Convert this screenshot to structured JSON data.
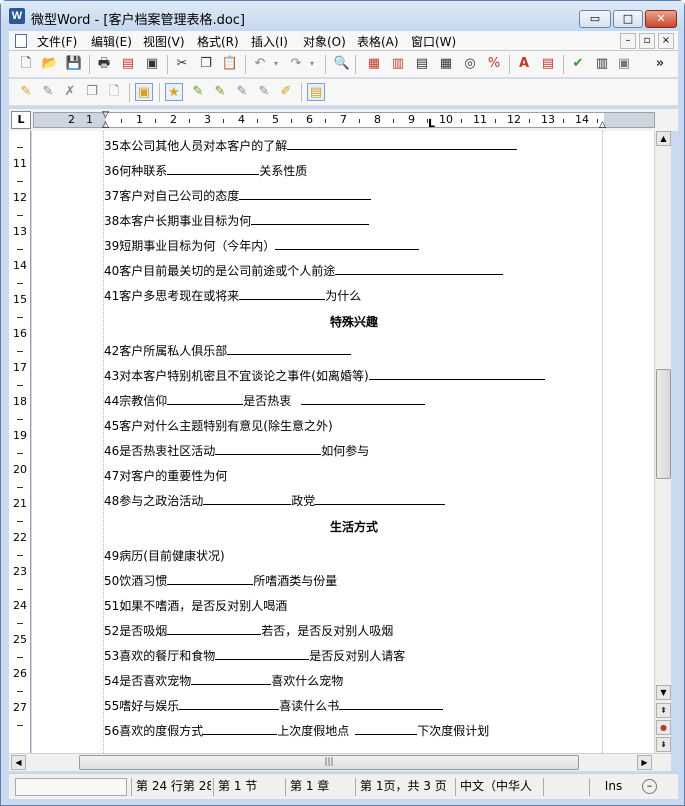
{
  "window": {
    "title": "微型Word - [客户档案管理表格.doc]",
    "app_icon_letter": "W",
    "min_glyph": "▭",
    "max_glyph": "□",
    "close_glyph": "✕"
  },
  "menubar": {
    "items": [
      "文件(F)",
      "编辑(E)",
      "视图(V)",
      "格式(R)",
      "插入(I)",
      "对象(O)",
      "表格(A)",
      "窗口(W)"
    ],
    "doc_controls": [
      "–",
      "▫",
      "×"
    ]
  },
  "toolbar": {
    "more_glyph": "»"
  },
  "ruler": {
    "corner_label": "L",
    "h_numbers": [
      "2",
      "1",
      "",
      "1",
      "2",
      "3",
      "4",
      "5",
      "6",
      "7",
      "8",
      "9",
      "10",
      "11",
      "12",
      "13",
      "14"
    ],
    "v_numbers": [
      "11",
      "12",
      "13",
      "14",
      "15",
      "16",
      "17",
      "18",
      "19",
      "20",
      "21",
      "22",
      "23",
      "24",
      "25",
      "26",
      "27"
    ]
  },
  "document": {
    "lines": [
      {
        "t1": "35本公司其他人员对本客户的了解",
        "t2": "",
        "t3": ""
      },
      {
        "t1": "36何种联系",
        "t2": "关系性质",
        "t3": ""
      },
      {
        "t1": "37客户对自己公司的态度",
        "t2": "",
        "t3": ""
      },
      {
        "t1": "38本客户长期事业目标为何",
        "t2": "",
        "t3": ""
      },
      {
        "t1": "39短期事业目标为何（今年内）",
        "t2": "",
        "t3": ""
      },
      {
        "t1": "40客户目前最关切的是公司前途或个人前途",
        "t2": "",
        "t3": ""
      },
      {
        "t1": "41客户多思考现在或将来",
        "t2": "为什么",
        "t3": ""
      },
      {
        "t1": "42客户所属私人俱乐部",
        "t2": "",
        "t3": ""
      },
      {
        "t1": "43对本客户特别机密且不宜谈论之事件(如离婚等)",
        "t2": "",
        "t3": ""
      },
      {
        "t1": "44宗教信仰",
        "t2": "是否热衷",
        "t3": ""
      },
      {
        "t1": "45客户对什么主题特别有意见(除生意之外)",
        "t2": "",
        "t3": ""
      },
      {
        "t1": "46是否热衷社区活动",
        "t2": "如何参与",
        "t3": ""
      },
      {
        "t1": "47对客户的重要性为何",
        "t2": "",
        "t3": ""
      },
      {
        "t1": "48参与之政治活动",
        "t2": "政党",
        "t3": ""
      },
      {
        "t1": "49病历(目前健康状况)",
        "t2": "",
        "t3": ""
      },
      {
        "t1": "50饮酒习惯",
        "t2": "所嗜酒类与份量",
        "t3": ""
      },
      {
        "t1": "51如果不嗜酒，是否反对别人喝酒",
        "t2": "",
        "t3": ""
      },
      {
        "t1": "52是否吸烟",
        "t2": "若否，是否反对别人吸烟",
        "t3": ""
      },
      {
        "t1": "53喜欢的餐厅和食物",
        "t2": "是否反对别人请客",
        "t3": ""
      },
      {
        "t1": "54是否喜欢宠物",
        "t2": "喜欢什么宠物",
        "t3": ""
      },
      {
        "t1": "55嗜好与娱乐",
        "t2": "喜读什么书",
        "t3": ""
      },
      {
        "t1": "56喜欢的度假方式",
        "t2": "上次度假地点",
        "t3": "下次度假计划"
      }
    ],
    "headings": [
      "特殊兴趣",
      "生活方式"
    ]
  },
  "scroll": {
    "up": "▲",
    "down": "▼",
    "hthumb_grip": "|||",
    "left": "◀",
    "right": "▶",
    "browse_prev": "⇞",
    "browse_select": "●",
    "browse_next": "⇟"
  },
  "status": {
    "line_col": "第 24 行第 28",
    "section": "第 1 节",
    "chapter": "第 1 章",
    "page": "第 1页，共 3 页",
    "language": "中文（中华人",
    "ins": "Ins",
    "zoom_glyph": "–"
  }
}
